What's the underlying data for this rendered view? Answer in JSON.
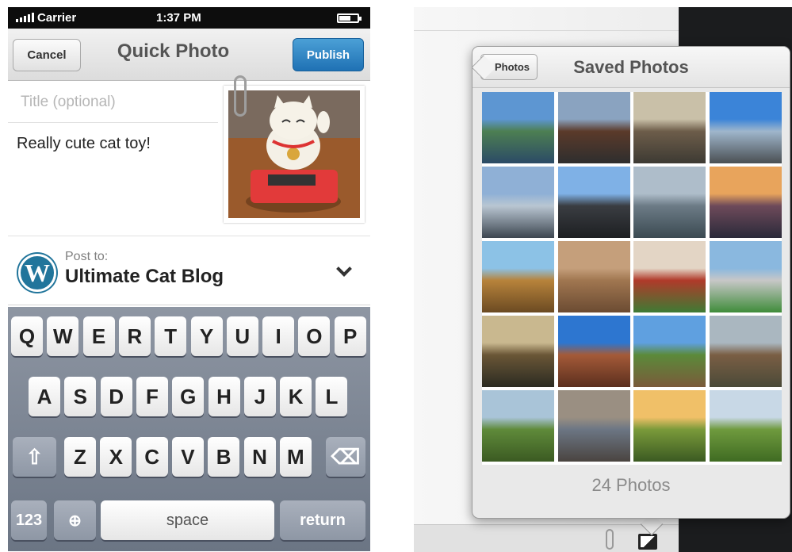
{
  "status_bar": {
    "carrier": "Carrier",
    "time": "1:37 PM"
  },
  "quick_photo": {
    "cancel_label": "Cancel",
    "title": "Quick Photo",
    "publish_label": "Publish",
    "title_placeholder": "Title (optional)",
    "body_text": "Really cute cat toy!",
    "post_to_label": "Post to:",
    "blog_name": "Ultimate Cat Blog",
    "wp_logo_letter": "W"
  },
  "keyboard": {
    "row1": [
      "Q",
      "W",
      "E",
      "R",
      "T",
      "Y",
      "U",
      "I",
      "O",
      "P"
    ],
    "row2": [
      "A",
      "S",
      "D",
      "F",
      "G",
      "H",
      "J",
      "K",
      "L"
    ],
    "row3": [
      "Z",
      "X",
      "C",
      "V",
      "B",
      "N",
      "M"
    ],
    "numbers_label": "123",
    "space_label": "space",
    "return_label": "return"
  },
  "saved_photos": {
    "back_label": "Photos",
    "title": "Saved Photos",
    "count_label": "24 Photos",
    "tiles": [
      {
        "name": "lake-reflection",
        "colors": [
          "#5d96d2",
          "#4d7f52",
          "#2b4a66"
        ]
      },
      {
        "name": "chicago-street",
        "colors": [
          "#8aa3c0",
          "#5b3a2a",
          "#2e2e2e"
        ]
      },
      {
        "name": "city-waterfront",
        "colors": [
          "#c9c0a8",
          "#6d5d4a",
          "#3d3a33"
        ]
      },
      {
        "name": "skyline-blue",
        "colors": [
          "#3b84d8",
          "#9fb6cc",
          "#4a4f52"
        ]
      },
      {
        "name": "cloud-gate",
        "colors": [
          "#8fb0d6",
          "#b9c6d2",
          "#3d4650"
        ]
      },
      {
        "name": "skyscraper",
        "colors": [
          "#7fb1e6",
          "#3a3d42",
          "#1d1f22"
        ]
      },
      {
        "name": "aerial-harbor",
        "colors": [
          "#aebdca",
          "#6c7b86",
          "#3b4a52"
        ]
      },
      {
        "name": "sunset-aerial",
        "colors": [
          "#e8a45c",
          "#6e4a5a",
          "#2a2a3a"
        ]
      },
      {
        "name": "pumpkin-field",
        "colors": [
          "#8cc2e6",
          "#b7833b",
          "#6b4a22"
        ]
      },
      {
        "name": "teddy-bear",
        "colors": [
          "#c59f7b",
          "#a07650",
          "#6b4b32"
        ]
      },
      {
        "name": "stadium-red",
        "colors": [
          "#e3d5c5",
          "#b03a2a",
          "#3e7b34"
        ]
      },
      {
        "name": "ballpark",
        "colors": [
          "#8ab8df",
          "#c7c7c7",
          "#3f8c3a"
        ]
      },
      {
        "name": "college-arch",
        "colors": [
          "#c9b88f",
          "#6a5636",
          "#2b2b22"
        ]
      },
      {
        "name": "brick-building",
        "colors": [
          "#2d76d0",
          "#a45a38",
          "#5b2f1e"
        ]
      },
      {
        "name": "tree-street",
        "colors": [
          "#5fa0e0",
          "#5b8a3a",
          "#7a5a3a"
        ]
      },
      {
        "name": "stone-houses",
        "colors": [
          "#aab7c0",
          "#7a5e44",
          "#4a4a38"
        ]
      },
      {
        "name": "green-valley",
        "colors": [
          "#a9c4d8",
          "#5f8a3a",
          "#3b5a22"
        ]
      },
      {
        "name": "lighter-pebbles",
        "colors": [
          "#9a8f82",
          "#6c7684",
          "#4a4440"
        ]
      },
      {
        "name": "golden-field",
        "colors": [
          "#f0c068",
          "#7a9a3a",
          "#3b5a22"
        ]
      },
      {
        "name": "hill-panorama",
        "colors": [
          "#c8d8e6",
          "#6f9a3e",
          "#3f6b22"
        ]
      },
      {
        "name": "extra-1",
        "colors": [
          "#8fb0d6",
          "#6f9a3e",
          "#3f6b22"
        ]
      },
      {
        "name": "extra-2",
        "colors": [
          "#c9c0a8",
          "#6d5d4a",
          "#3d3a33"
        ]
      },
      {
        "name": "extra-3",
        "colors": [
          "#3b84d8",
          "#9fb6cc",
          "#4a4f52"
        ]
      },
      {
        "name": "extra-4",
        "colors": [
          "#e8a45c",
          "#6e4a5a",
          "#2a2a3a"
        ]
      }
    ]
  }
}
